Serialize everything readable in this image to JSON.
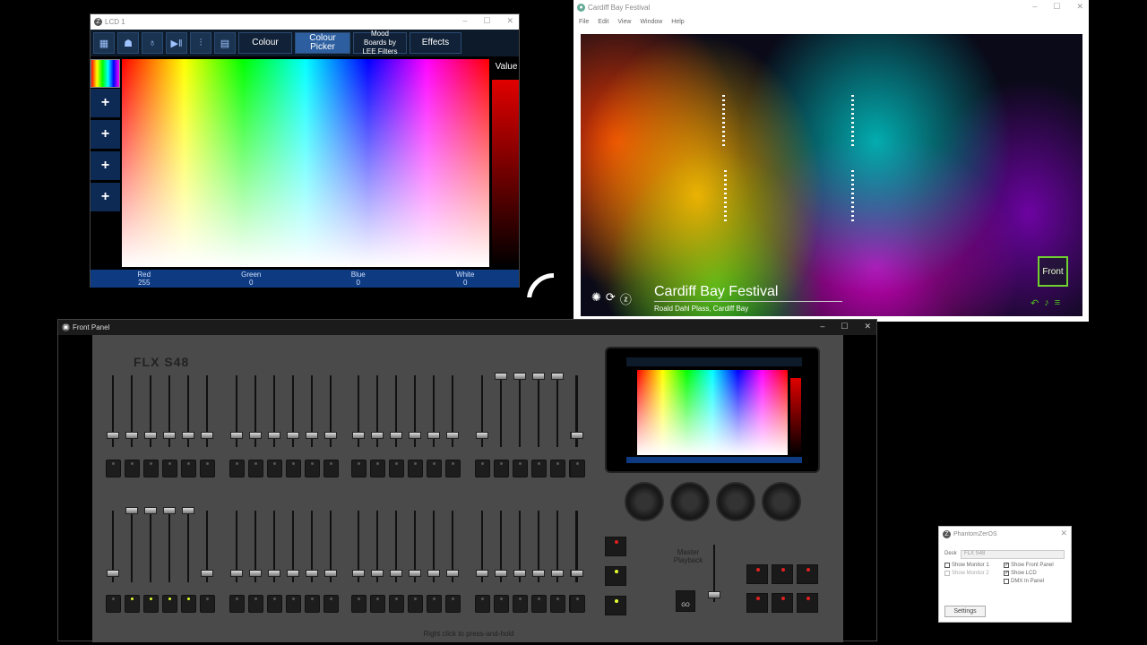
{
  "lcd": {
    "title": "LCD 1",
    "tabs": {
      "colour": "Colour",
      "picker": "Colour Picker",
      "mood": "Mood Boards by LEE Filters",
      "effects": "Effects"
    },
    "value_label": "Value",
    "footer": [
      {
        "name": "Red",
        "value": "255"
      },
      {
        "name": "Green",
        "value": "0"
      },
      {
        "name": "Blue",
        "value": "0"
      },
      {
        "name": "White",
        "value": "0"
      }
    ]
  },
  "video": {
    "title": "Cardiff Bay Festival",
    "menu": [
      "File",
      "Edit",
      "View",
      "Window",
      "Help"
    ],
    "event_title": "Cardiff Bay Festival",
    "event_subtitle": "Roald Dahl Plass, Cardiff Bay",
    "front_button": "Front"
  },
  "front_panel": {
    "title": "Front Panel",
    "logo": "FLX S48",
    "master_label": "Master Playback",
    "go_label": "GO",
    "hint": "Right click to press-and-hold"
  },
  "phantom": {
    "title": "PhantomZerOS",
    "desk_label": "Desk",
    "desk_value": "FLX S48",
    "show_monitor_1": "Show Monitor 1",
    "show_monitor_2": "Show Monitor 2",
    "show_front_panel": "Show Front Panel",
    "show_lcd": "Show LCD",
    "dmx_in_panel": "DMX In Panel",
    "settings": "Settings"
  }
}
